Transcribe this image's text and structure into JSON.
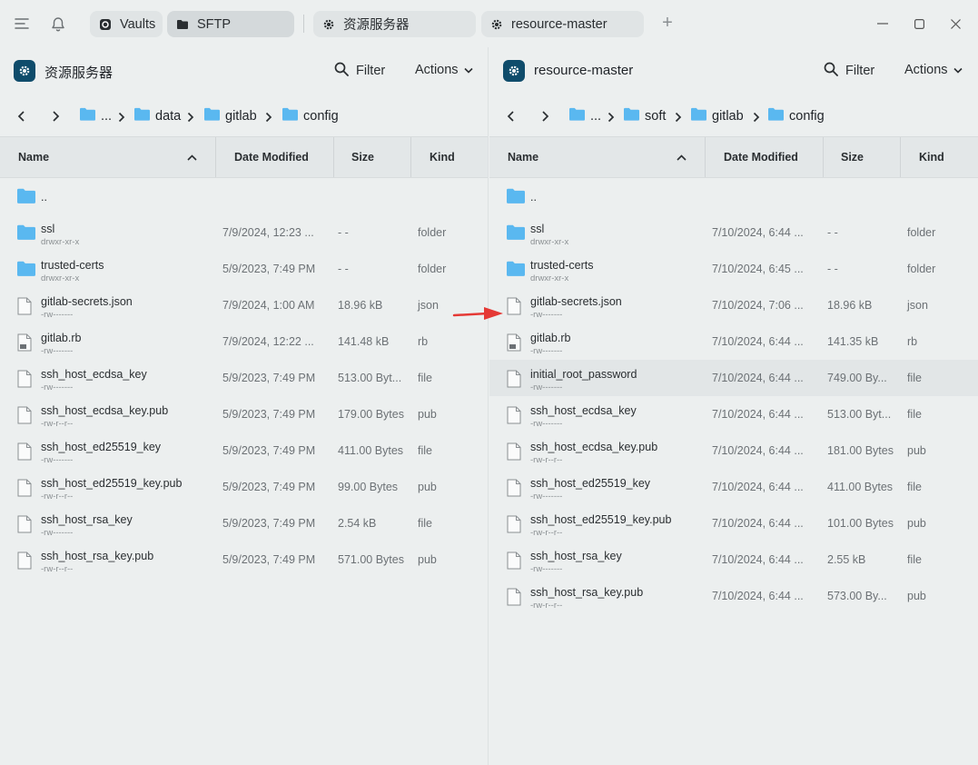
{
  "tabs": {
    "vaults": "Vaults",
    "sftp": "SFTP",
    "host1": "资源服务器",
    "host2": "resource-master",
    "new_tab": "+"
  },
  "left": {
    "title": "资源服务器",
    "filter": "Filter",
    "actions": "Actions",
    "crumbs": [
      "...",
      "data",
      "gitlab",
      "config"
    ],
    "columns": {
      "name": "Name",
      "date": "Date Modified",
      "size": "Size",
      "kind": "Kind"
    },
    "files": [
      {
        "name": "..",
        "perm": "",
        "date": "",
        "size": "",
        "kind": "",
        "type": "folder"
      },
      {
        "name": "ssl",
        "perm": "drwxr-xr-x",
        "date": "7/9/2024, 12:23 ...",
        "size": "- -",
        "kind": "folder",
        "type": "folder"
      },
      {
        "name": "trusted-certs",
        "perm": "drwxr-xr-x",
        "date": "5/9/2023, 7:49 PM",
        "size": "- -",
        "kind": "folder",
        "type": "folder"
      },
      {
        "name": "gitlab-secrets.json",
        "perm": "-rw-------",
        "date": "7/9/2024, 1:00 AM",
        "size": "18.96 kB",
        "kind": "json",
        "type": "file"
      },
      {
        "name": "gitlab.rb",
        "perm": "-rw-------",
        "date": "7/9/2024, 12:22 ...",
        "size": "141.48 kB",
        "kind": "rb",
        "type": "rb"
      },
      {
        "name": "ssh_host_ecdsa_key",
        "perm": "-rw-------",
        "date": "5/9/2023, 7:49 PM",
        "size": "513.00 Byt...",
        "kind": "file",
        "type": "file"
      },
      {
        "name": "ssh_host_ecdsa_key.pub",
        "perm": "-rw-r--r--",
        "date": "5/9/2023, 7:49 PM",
        "size": "179.00 Bytes",
        "kind": "pub",
        "type": "file"
      },
      {
        "name": "ssh_host_ed25519_key",
        "perm": "-rw-------",
        "date": "5/9/2023, 7:49 PM",
        "size": "411.00 Bytes",
        "kind": "file",
        "type": "file"
      },
      {
        "name": "ssh_host_ed25519_key.pub",
        "perm": "-rw-r--r--",
        "date": "5/9/2023, 7:49 PM",
        "size": "99.00 Bytes",
        "kind": "pub",
        "type": "file"
      },
      {
        "name": "ssh_host_rsa_key",
        "perm": "-rw-------",
        "date": "5/9/2023, 7:49 PM",
        "size": "2.54 kB",
        "kind": "file",
        "type": "file"
      },
      {
        "name": "ssh_host_rsa_key.pub",
        "perm": "-rw-r--r--",
        "date": "5/9/2023, 7:49 PM",
        "size": "571.00 Bytes",
        "kind": "pub",
        "type": "file"
      }
    ]
  },
  "right": {
    "title": "resource-master",
    "filter": "Filter",
    "actions": "Actions",
    "crumbs": [
      "...",
      "soft",
      "gitlab",
      "config"
    ],
    "columns": {
      "name": "Name",
      "date": "Date Modified",
      "size": "Size",
      "kind": "Kind"
    },
    "files": [
      {
        "name": "..",
        "perm": "",
        "date": "",
        "size": "",
        "kind": "",
        "type": "folder"
      },
      {
        "name": "ssl",
        "perm": "drwxr-xr-x",
        "date": "7/10/2024, 6:44 ...",
        "size": "- -",
        "kind": "folder",
        "type": "folder"
      },
      {
        "name": "trusted-certs",
        "perm": "drwxr-xr-x",
        "date": "7/10/2024, 6:45 ...",
        "size": "- -",
        "kind": "folder",
        "type": "folder"
      },
      {
        "name": "gitlab-secrets.json",
        "perm": "-rw-------",
        "date": "7/10/2024, 7:06 ...",
        "size": "18.96 kB",
        "kind": "json",
        "type": "file"
      },
      {
        "name": "gitlab.rb",
        "perm": "-rw-------",
        "date": "7/10/2024, 6:44 ...",
        "size": "141.35 kB",
        "kind": "rb",
        "type": "rb"
      },
      {
        "name": "initial_root_password",
        "perm": "-rw-------",
        "date": "7/10/2024, 6:44 ...",
        "size": "749.00 By...",
        "kind": "file",
        "type": "file",
        "highlight": true
      },
      {
        "name": "ssh_host_ecdsa_key",
        "perm": "-rw-------",
        "date": "7/10/2024, 6:44 ...",
        "size": "513.00 Byt...",
        "kind": "file",
        "type": "file"
      },
      {
        "name": "ssh_host_ecdsa_key.pub",
        "perm": "-rw-r--r--",
        "date": "7/10/2024, 6:44 ...",
        "size": "181.00 Bytes",
        "kind": "pub",
        "type": "file"
      },
      {
        "name": "ssh_host_ed25519_key",
        "perm": "-rw-------",
        "date": "7/10/2024, 6:44 ...",
        "size": "411.00 Bytes",
        "kind": "file",
        "type": "file"
      },
      {
        "name": "ssh_host_ed25519_key.pub",
        "perm": "-rw-r--r--",
        "date": "7/10/2024, 6:44 ...",
        "size": "101.00 Bytes",
        "kind": "pub",
        "type": "file"
      },
      {
        "name": "ssh_host_rsa_key",
        "perm": "-rw-------",
        "date": "7/10/2024, 6:44 ...",
        "size": "2.55 kB",
        "kind": "file",
        "type": "file"
      },
      {
        "name": "ssh_host_rsa_key.pub",
        "perm": "-rw-r--r--",
        "date": "7/10/2024, 6:44 ...",
        "size": "573.00 By...",
        "kind": "pub",
        "type": "file"
      }
    ]
  },
  "colors": {
    "accent": "#0f4c6b",
    "folder": "#5ab8f0",
    "annotation": "#e53935"
  }
}
